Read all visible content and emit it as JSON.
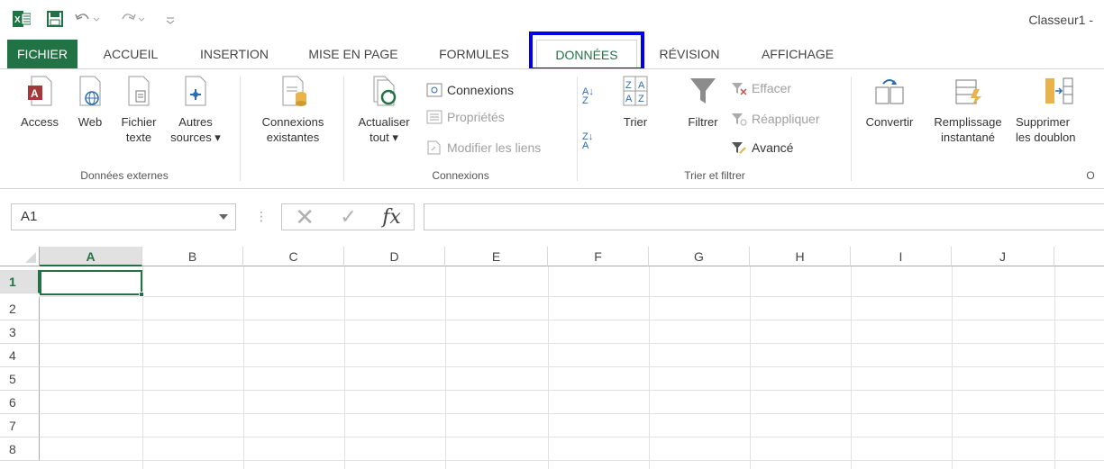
{
  "window": {
    "title": "Classeur1 -"
  },
  "tabs": [
    {
      "label": "FICHIER"
    },
    {
      "label": "ACCUEIL"
    },
    {
      "label": "INSERTION"
    },
    {
      "label": "MISE EN PAGE"
    },
    {
      "label": "FORMULES"
    },
    {
      "label": "DONNÉES"
    },
    {
      "label": "RÉVISION"
    },
    {
      "label": "AFFICHAGE"
    }
  ],
  "ribbon": {
    "external": {
      "access": "Access",
      "web": "Web",
      "fichier_texte": [
        "Fichier",
        "texte"
      ],
      "autres_sources": [
        "Autres",
        "sources ▾"
      ],
      "group_label": "Données externes"
    },
    "existing": {
      "label": [
        "Connexions",
        "existantes"
      ]
    },
    "connections": {
      "refresh": [
        "Actualiser",
        "tout ▾"
      ],
      "connexions": "Connexions",
      "proprietes": "Propriétés",
      "modifier_liens": "Modifier les liens",
      "group_label": "Connexions"
    },
    "sort_filter": {
      "sort_az": "A↓Z",
      "sort_za": "Z↓A",
      "trier": "Trier",
      "filtrer": "Filtrer",
      "effacer": "Effacer",
      "reappliquer": "Réappliquer",
      "avance": "Avancé",
      "group_label": "Trier et filtrer"
    },
    "tools": {
      "convertir": "Convertir",
      "remplissage": [
        "Remplissage",
        "instantané"
      ],
      "supprimer": [
        "Supprimer",
        "les doublon"
      ],
      "group_label_partial": "O"
    }
  },
  "formula_bar": {
    "name_box": "A1",
    "cancel_glyph": "✕",
    "enter_glyph": "✓",
    "fx": "fx",
    "dots": "⋮",
    "value": ""
  },
  "grid": {
    "columns": [
      "A",
      "B",
      "C",
      "D",
      "E",
      "F",
      "G",
      "H",
      "I",
      "J"
    ],
    "rows": [
      "1",
      "2",
      "3",
      "4",
      "5",
      "6",
      "7",
      "8"
    ],
    "selected_cell": "A1"
  },
  "colors": {
    "accent": "#217346",
    "highlight": "#0000ee"
  }
}
